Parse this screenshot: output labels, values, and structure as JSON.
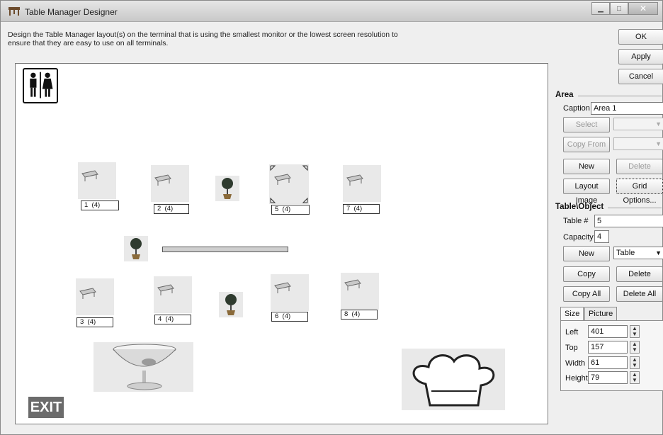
{
  "window": {
    "title": "Table Manager Designer",
    "icon": "table-icon"
  },
  "instructions": "Design the Table Manager layout(s) on the terminal that is using the smallest monitor or the lowest screen resolution to ensure that they are easy to use on all terminals.",
  "actions": {
    "ok": "OK",
    "apply": "Apply",
    "cancel": "Cancel"
  },
  "area": {
    "heading": "Area",
    "caption_label": "Caption",
    "caption_value": "Area 1",
    "select_label": "Select",
    "copy_from_label": "Copy From",
    "new_label": "New",
    "delete_label": "Delete",
    "layout_image_label": "Layout Image",
    "grid_options_label": "Grid Options..."
  },
  "table_object": {
    "heading": "Table\\Object",
    "table_no_label": "Table #",
    "table_no_value": "5",
    "capacity_label": "Capacity",
    "capacity_value": "4",
    "new_label": "New",
    "type_value": "Table",
    "delete_label": "Delete",
    "copy_label": "Copy",
    "copy_all_label": "Copy All",
    "delete_all_label": "Delete All"
  },
  "tabs": {
    "size": "Size",
    "picture": "Picture"
  },
  "size": {
    "left_label": "Left",
    "left_value": "401",
    "top_label": "Top",
    "top_value": "157",
    "width_label": "Width",
    "width_value": "61",
    "height_label": "Height",
    "height_value": "79"
  },
  "tables": [
    {
      "label": "1  (4)"
    },
    {
      "label": "2  (4)"
    },
    {
      "label": "5  (4)",
      "selected": true
    },
    {
      "label": "7  (4)"
    },
    {
      "label": "3  (4)"
    },
    {
      "label": "4  (4)"
    },
    {
      "label": "6  (4)"
    },
    {
      "label": "8  (4)"
    }
  ],
  "canvas": {
    "exit_sign": "EXIT"
  }
}
